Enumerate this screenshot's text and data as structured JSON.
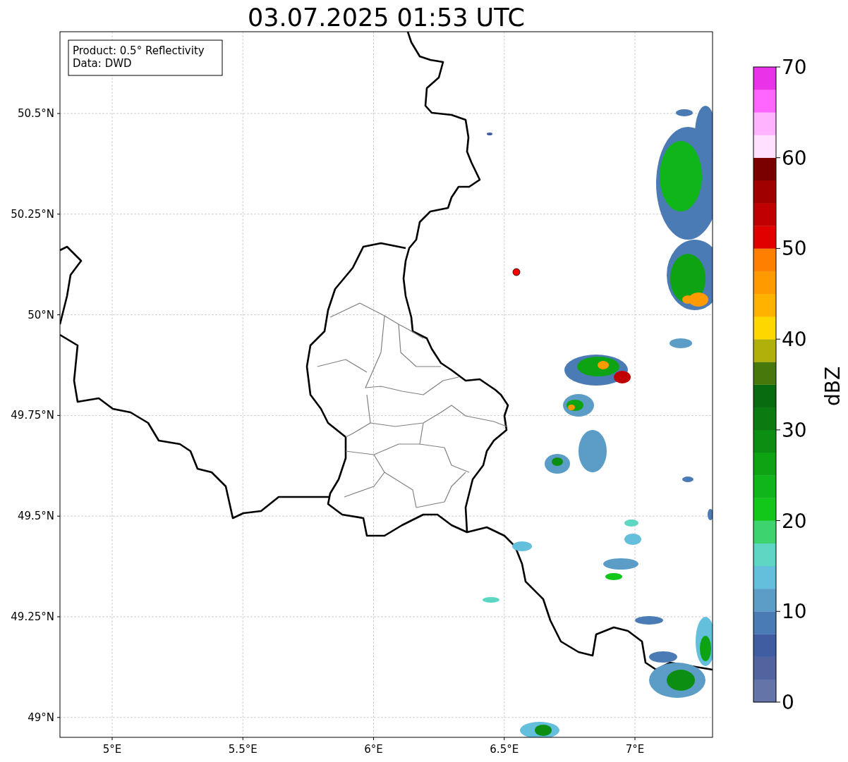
{
  "title": "03.07.2025 01:53 UTC",
  "info_box": [
    "Product: 0.5° Reflectivity",
    "Data: DWD"
  ],
  "lat_labels": [
    "50.5°N",
    "50.25°N",
    "50°N",
    "49.75°N",
    "49.5°N",
    "49.25°N",
    "49°N"
  ],
  "lon_labels": [
    "5°E",
    "5.5°E",
    "6°E",
    "6.5°E",
    "7°E"
  ],
  "colorbar": {
    "label": "dBZ",
    "ticks": [
      "70",
      "60",
      "50",
      "40",
      "30",
      "20",
      "10",
      "0"
    ],
    "bands": [
      {
        "color": "#6574a8"
      },
      {
        "color": "#5164a0"
      },
      {
        "color": "#415da1"
      },
      {
        "color": "#4b7bb4"
      },
      {
        "color": "#5b9dc6"
      },
      {
        "color": "#64bfdc"
      },
      {
        "color": "#5ed6c4"
      },
      {
        "color": "#3dd470"
      },
      {
        "color": "#12c71a"
      },
      {
        "color": "#10b51a"
      },
      {
        "color": "#0ea313"
      },
      {
        "color": "#0c8e12"
      },
      {
        "color": "#0b7a10"
      },
      {
        "color": "#086b0f"
      },
      {
        "color": "#47780c"
      },
      {
        "color": "#b0b00a"
      },
      {
        "color": "#ffd700"
      },
      {
        "color": "#ffb300"
      },
      {
        "color": "#ff9a00"
      },
      {
        "color": "#ff7f00"
      },
      {
        "color": "#e00000"
      },
      {
        "color": "#c00000"
      },
      {
        "color": "#a00000"
      },
      {
        "color": "#7a0000"
      },
      {
        "color": "#ffe0ff"
      },
      {
        "color": "#ffb3ff"
      },
      {
        "color": "#ff66ff"
      },
      {
        "color": "#e833e8"
      }
    ]
  }
}
